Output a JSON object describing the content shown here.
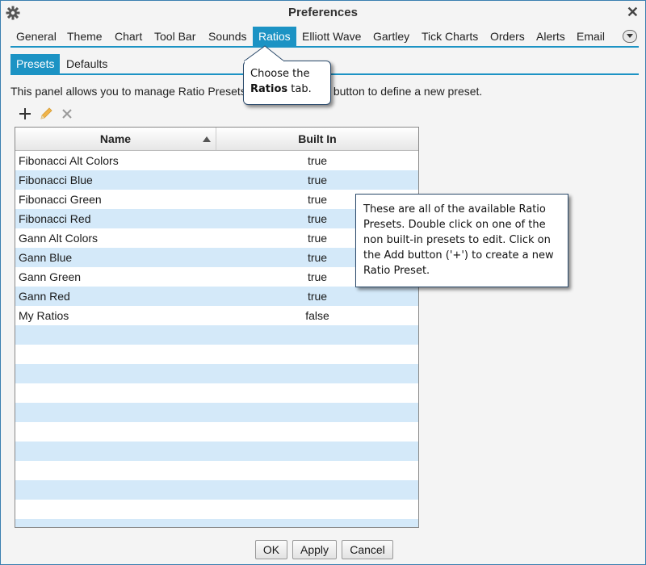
{
  "window": {
    "title": "Preferences"
  },
  "tabs": [
    {
      "label": "General"
    },
    {
      "label": "Theme"
    },
    {
      "label": "Chart"
    },
    {
      "label": "Tool Bar"
    },
    {
      "label": "Sounds"
    },
    {
      "label": "Ratios"
    },
    {
      "label": "Elliott Wave"
    },
    {
      "label": "Gartley"
    },
    {
      "label": "Tick Charts"
    },
    {
      "label": "Orders"
    },
    {
      "label": "Alerts"
    },
    {
      "label": "Email"
    }
  ],
  "active_tab": "Ratios",
  "subtabs": [
    {
      "label": "Presets"
    },
    {
      "label": "Defaults"
    }
  ],
  "description": {
    "before": "This panel allows you to manage Ratio Presets",
    "after": "button to define a new preset."
  },
  "toolbar": {
    "add_icon": "plus-icon",
    "edit_icon": "pencil-icon",
    "delete_icon": "x-icon"
  },
  "table": {
    "columns": [
      "Name",
      "Built In"
    ],
    "rows": [
      {
        "name": "Fibonacci Alt Colors",
        "built_in": "true"
      },
      {
        "name": "Fibonacci Blue",
        "built_in": "true"
      },
      {
        "name": "Fibonacci Green",
        "built_in": "true"
      },
      {
        "name": "Fibonacci Red",
        "built_in": "true"
      },
      {
        "name": "Gann Alt Colors",
        "built_in": "true"
      },
      {
        "name": "Gann Blue",
        "built_in": "true"
      },
      {
        "name": "Gann Green",
        "built_in": "true"
      },
      {
        "name": "Gann Red",
        "built_in": "true"
      },
      {
        "name": "My Ratios",
        "built_in": "false"
      }
    ]
  },
  "buttons": {
    "ok": "OK",
    "apply": "Apply",
    "cancel": "Cancel"
  },
  "callout_tab": {
    "line1": "Choose the",
    "bold": "Ratios",
    "rest": " tab."
  },
  "callout_table": {
    "lines": [
      "These are all of the available Ratio",
      "Presets.  Double click on one of the",
      "non built-in presets to edit.  Click on",
      "the Add button ('+') to create a new",
      "Ratio Preset."
    ]
  },
  "colors": {
    "accent": "#1c93c4",
    "row_alt": "#d4e9f9",
    "pencil": "#f0b44a"
  }
}
